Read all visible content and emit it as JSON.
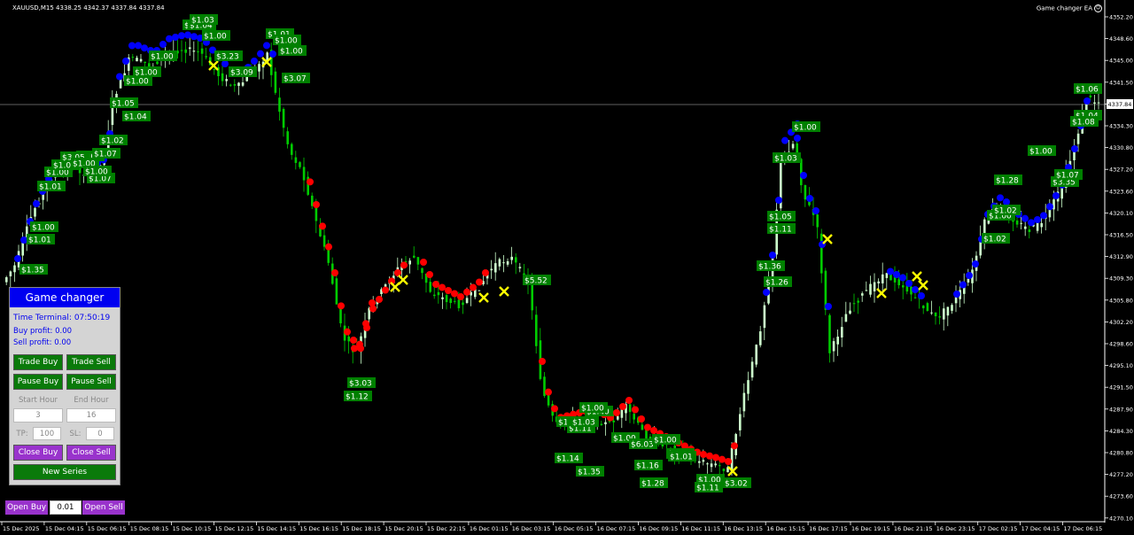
{
  "header": {
    "symbol_info": "XAUUSD,M15  4338.25 4342.37 4337.84 4337.84",
    "ea_name": "Game changer EA"
  },
  "price_axis": [
    "4352.20",
    "4348.60",
    "4345.00",
    "4341.50",
    "4337.84",
    "4334.30",
    "4330.80",
    "4327.20",
    "4323.60",
    "4320.10",
    "4316.50",
    "4312.90",
    "4309.30",
    "4305.80",
    "4302.20",
    "4298.60",
    "4295.10",
    "4291.50",
    "4287.90",
    "4284.30",
    "4280.80",
    "4277.20",
    "4273.60",
    "4270.10"
  ],
  "current_price": "4337.84",
  "time_axis": [
    "15 Dec 2025",
    "15 Dec 04:15",
    "15 Dec 06:15",
    "15 Dec 08:15",
    "15 Dec 10:15",
    "15 Dec 12:15",
    "15 Dec 14:15",
    "15 Dec 16:15",
    "15 Dec 18:15",
    "15 Dec 20:15",
    "15 Dec 22:15",
    "16 Dec 01:15",
    "16 Dec 03:15",
    "16 Dec 05:15",
    "16 Dec 07:15",
    "16 Dec 09:15",
    "16 Dec 11:15",
    "16 Dec 13:15",
    "16 Dec 15:15",
    "16 Dec 17:15",
    "16 Dec 19:15",
    "16 Dec 21:15",
    "16 Dec 23:15",
    "17 Dec 02:15",
    "17 Dec 04:15",
    "17 Dec 06:15"
  ],
  "profit_labels": [
    "$1.35",
    "$1.01",
    "$1.00",
    "$1.01",
    "$1.00",
    "$1.05",
    "$1.07",
    "$1.00",
    "$3.05",
    "$1.00",
    "$1.00",
    "$1.07",
    "$1.02",
    "$1.04",
    "$1.05",
    "$1.00",
    "$1.00",
    "$1.00",
    "$1.06",
    "$1.04",
    "$1.03",
    "$1.00",
    "$3.23",
    "$3.09",
    "$1.01",
    "$1.00",
    "$1.00",
    "$3.07",
    "$3.03",
    "$1.12",
    "$5.52",
    "$1.14",
    "$1.35",
    "$1.00",
    "$1.11",
    "$1.03",
    "$1.40",
    "$1.00",
    "$1.00",
    "$6.03",
    "$1.16",
    "$1.28",
    "$1.00",
    "$1.01",
    "$1.01",
    "$1.00",
    "$1.11",
    "$3.02",
    "$1.00",
    "$1.03",
    "$1.05",
    "$1.11",
    "$1.36",
    "$1.26",
    "$1.28",
    "$1.02",
    "$1.00",
    "$1.02",
    "$3.35",
    "$1.04",
    "$1.07",
    "$1.00",
    "$1.08",
    "$1.06"
  ],
  "panel": {
    "title": "Game changer",
    "time_terminal": "Time Terminal: 07:50:19",
    "buy_profit": "Buy profit: 0.00",
    "sell_profit": "Sell profit: 0.00",
    "trade_buy": "Trade Buy",
    "trade_sell": "Trade Sell",
    "pause_buy": "Pause Buy",
    "pause_sell": "Pause Sell",
    "start_hour_label": "Start Hour",
    "end_hour_label": "End Hour",
    "start_hour": "3",
    "end_hour": "16",
    "tp_label": "TP:",
    "tp_value": "100",
    "sl_label": "SL:",
    "sl_value": "0",
    "close_buy": "Close Buy",
    "close_sell": "Close Sell",
    "new_series": "New Series"
  },
  "bottom": {
    "open_buy": "Open Buy",
    "lot": "0.01",
    "open_sell": "Open Sell"
  },
  "colors": {
    "bull": "#ccffcc",
    "bear": "#00cc00",
    "buy_dot": "#0000ff",
    "sell_dot": "#ff0000",
    "label_bg": "#008000",
    "close_mark": "#ffff00"
  }
}
